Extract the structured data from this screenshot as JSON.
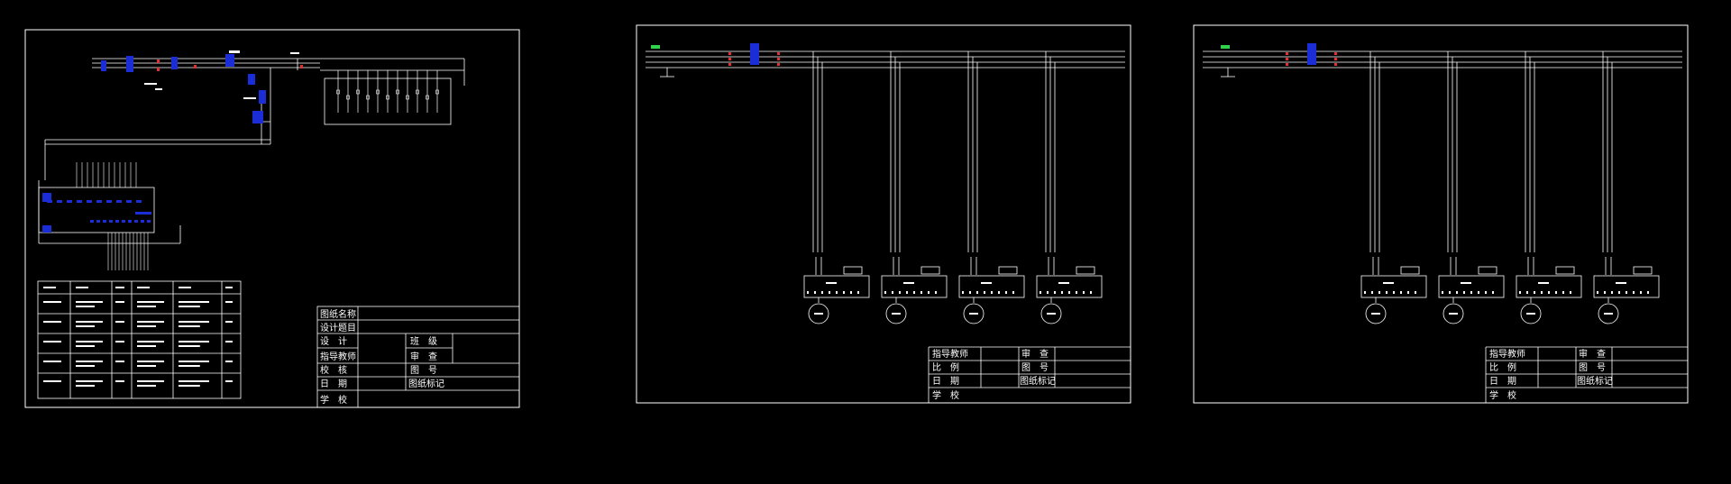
{
  "sheet1": {
    "title_block": {
      "drawing_name": "图纸名称",
      "design_topic": "设计题目",
      "design": "设　计",
      "instructor": "指导教师",
      "check": "校　核",
      "date": "日　期",
      "school": "学　校",
      "class_label": "班　级",
      "review": "审　查",
      "drawing_no": "图　号",
      "drawing_mark": "图纸标记"
    }
  },
  "sheet2": {
    "title_block": {
      "instructor": "指导教师",
      "review": "审　查",
      "scale": "比　例",
      "drawing_no": "图　号",
      "date": "日　期",
      "drawing_mark": "图纸标记",
      "school": "学　校"
    }
  },
  "sheet3": {
    "title_block": {
      "instructor": "指导教师",
      "review": "审　查",
      "scale": "比　例",
      "drawing_no": "图　号",
      "date": "日　期",
      "drawing_mark": "图纸标记",
      "school": "学　校"
    }
  },
  "colors": {
    "background": "#000000",
    "frame": "#ffffff",
    "component_blue": "#1a2dd6",
    "terminal_red": "#e23030",
    "indicator_green": "#2fd24a"
  }
}
